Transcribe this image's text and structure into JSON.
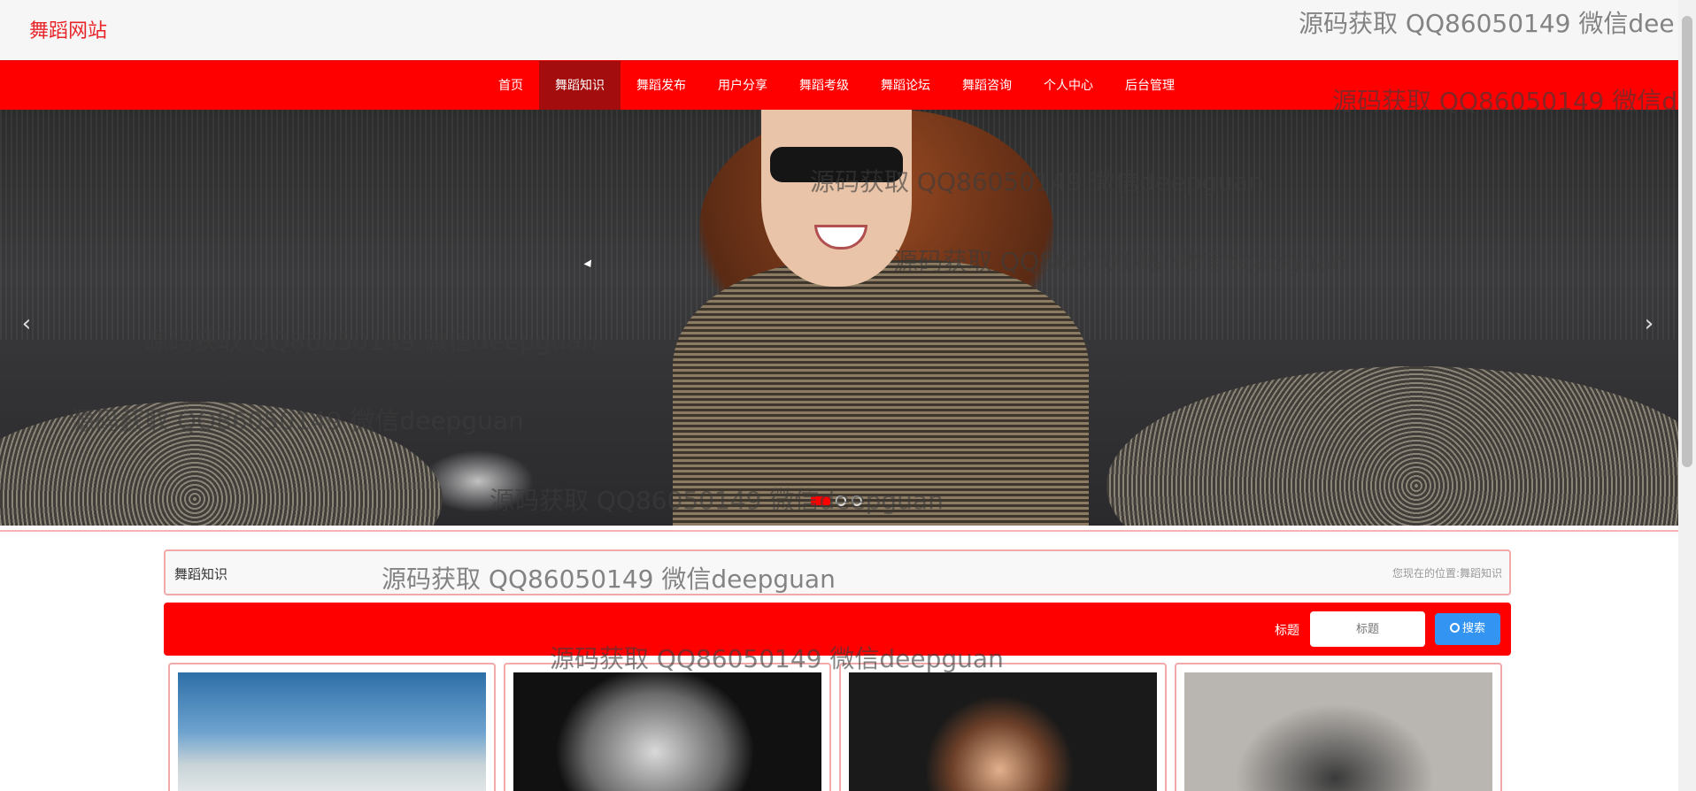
{
  "site": {
    "title": "舞蹈网站"
  },
  "nav": {
    "items": [
      {
        "label": "首页"
      },
      {
        "label": "舞蹈知识"
      },
      {
        "label": "舞蹈发布"
      },
      {
        "label": "用户分享"
      },
      {
        "label": "舞蹈考级"
      },
      {
        "label": "舞蹈论坛"
      },
      {
        "label": "舞蹈咨询"
      },
      {
        "label": "个人中心"
      },
      {
        "label": "后台管理"
      }
    ],
    "active_index": 1
  },
  "banner": {
    "prev_icon": "‹",
    "next_icon": "›",
    "slide_count": 3,
    "active_slide": 1
  },
  "breadcrumb": {
    "title": "舞蹈知识",
    "position_label": "您现在的位置:",
    "position_value": "舞蹈知识"
  },
  "search": {
    "label": "标题",
    "placeholder": "标题",
    "button_label": "搜索"
  },
  "cards": [
    {
      "image": "mayday-poster"
    },
    {
      "image": "artist-portrait"
    },
    {
      "image": "artist-portrait"
    },
    {
      "image": "couple-guitar-photo"
    }
  ],
  "watermark": {
    "text": "源码获取 QQ86050149 微信deepguan",
    "text_cut_1": "源码获取 QQ86050149 微信dee",
    "text_cut_2": "源码获取 QQ86050149 微信d"
  },
  "colors": {
    "brand_red": "#fe0000",
    "nav_active": "#a30d0d",
    "title_red": "#e8262a",
    "search_button": "#3494f1"
  }
}
